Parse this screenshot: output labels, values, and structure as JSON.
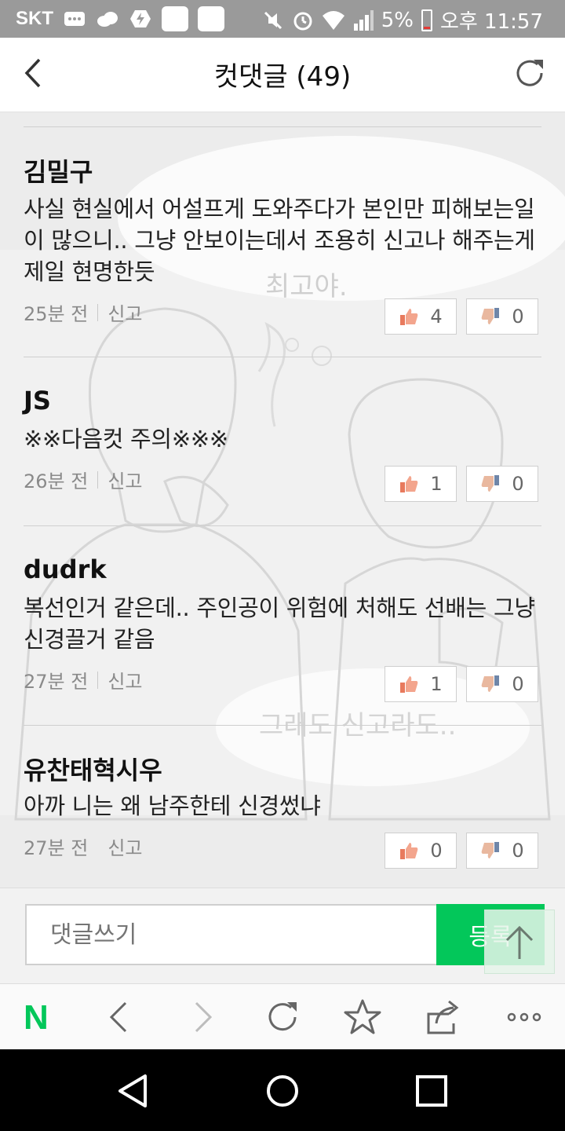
{
  "status_bar": {
    "carrier": "SKT",
    "battery": "5%",
    "time": "오후 11:57"
  },
  "header": {
    "title": "컷댓글",
    "count": "(49)"
  },
  "comments": [
    {
      "author": "김밀구",
      "body": "사실 현실에서 어설프게 도와주다가 본인만 피해보는일이 많으니.. 그냥 안보이는데서 조용히 신고나 해주는게 제일 현명한듯",
      "time": "25분 전",
      "report": "신고",
      "likes": "4",
      "dislikes": "0"
    },
    {
      "author": "JS",
      "body": "※※다음컷 주의※※※",
      "time": "26분 전",
      "report": "신고",
      "likes": "1",
      "dislikes": "0"
    },
    {
      "author": "dudrk",
      "body": "복선인거 같은데.. 주인공이 위험에 처해도 선배는 그냥 신경끌거 같음",
      "time": "27분 전",
      "report": "신고",
      "likes": "1",
      "dislikes": "0"
    },
    {
      "author": "유찬태혁시우",
      "body": "아까 니는 왜 남주한테 신경썼냐",
      "time": "27분 전",
      "report": "신고",
      "likes": "0",
      "dislikes": "0"
    }
  ],
  "background_art": {
    "bubble_top_text": "최고야.",
    "bubble_bottom_text": "그래도 신고라도.."
  },
  "comment_box": {
    "placeholder": "댓글쓰기",
    "submit_label": "등록"
  },
  "browser_bar": {
    "logo": "N"
  },
  "colors": {
    "accent": "#03c75a",
    "status_bar": "#9a9a9a",
    "background": "#ededed"
  }
}
